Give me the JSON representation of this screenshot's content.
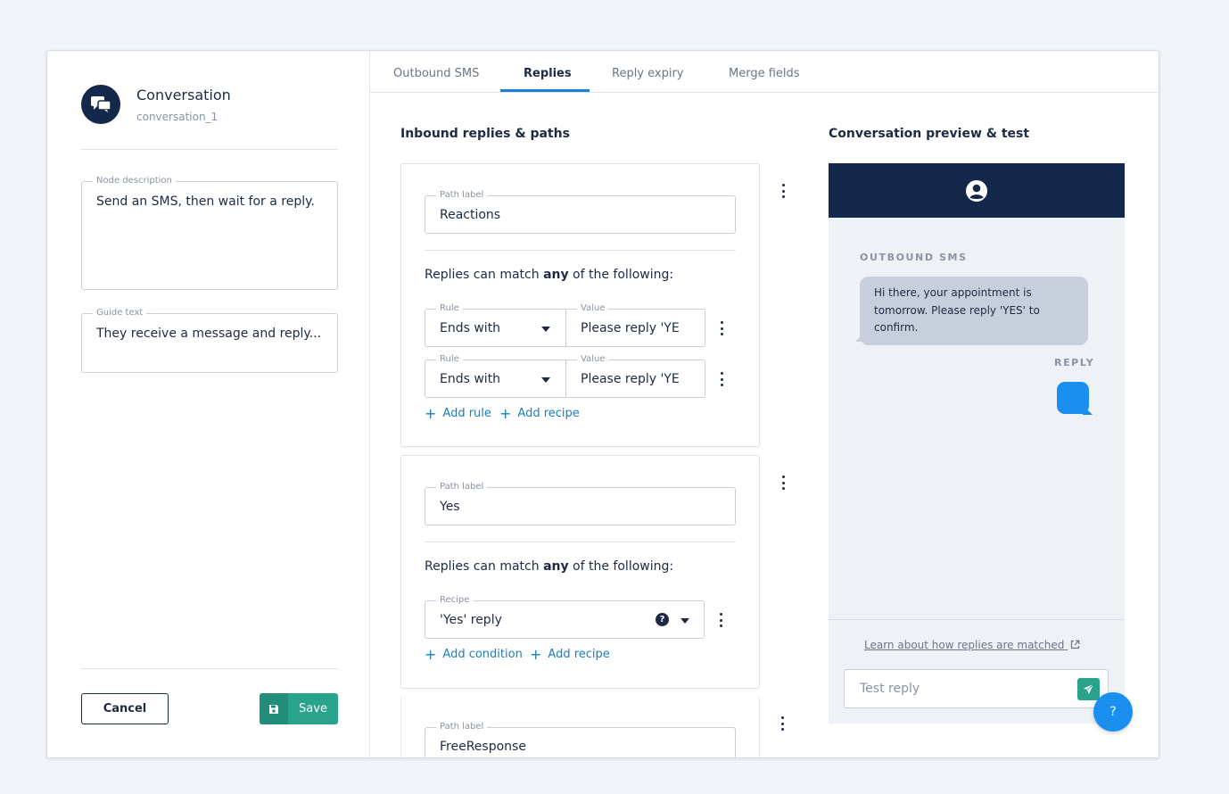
{
  "node": {
    "title": "Conversation",
    "subtitle": "conversation_1",
    "description_label": "Node description",
    "description_value": "Send an SMS, then wait for a reply.",
    "guide_label": "Guide text",
    "guide_value": "They receive a message and reply..."
  },
  "footer": {
    "cancel_label": "Cancel",
    "save_label": "Save"
  },
  "tabs": [
    {
      "label": "Outbound SMS",
      "active": false
    },
    {
      "label": "Replies",
      "active": true
    },
    {
      "label": "Reply expiry",
      "active": false
    },
    {
      "label": "Merge fields",
      "active": false
    }
  ],
  "replies": {
    "title": "Inbound replies & paths",
    "match_prefix": "Replies can match ",
    "match_emphasis": "any",
    "match_suffix": " of the following:",
    "path_label_caption": "Path label",
    "rule_caption": "Rule",
    "value_caption": "Value",
    "recipe_caption": "Recipe",
    "paths": [
      {
        "label": "Reactions",
        "rules": [
          {
            "rule": "Ends with",
            "value": "Please reply 'YE"
          },
          {
            "rule": "Ends with",
            "value": "Please reply 'YE"
          }
        ],
        "add_rule": "Add rule",
        "add_recipe": "Add recipe"
      },
      {
        "label": "Yes",
        "recipe": "'Yes' reply",
        "add_condition": "Add condition",
        "add_recipe": "Add recipe"
      },
      {
        "label": "FreeResponse"
      }
    ]
  },
  "preview": {
    "title": "Conversation preview & test",
    "outbound_label": "OUTBOUND SMS",
    "outbound_message": "Hi there, your appointment is tomorrow. Please reply 'YES' to confirm.",
    "reply_label": "REPLY",
    "learn_link": "Learn about how replies are matched",
    "test_placeholder": "Test reply"
  },
  "help_label": "?",
  "colors": {
    "navy": "#13284a",
    "accent_blue": "#1a8ff0",
    "save_green": "#29a38c",
    "link_blue": "#1a7fbf"
  }
}
